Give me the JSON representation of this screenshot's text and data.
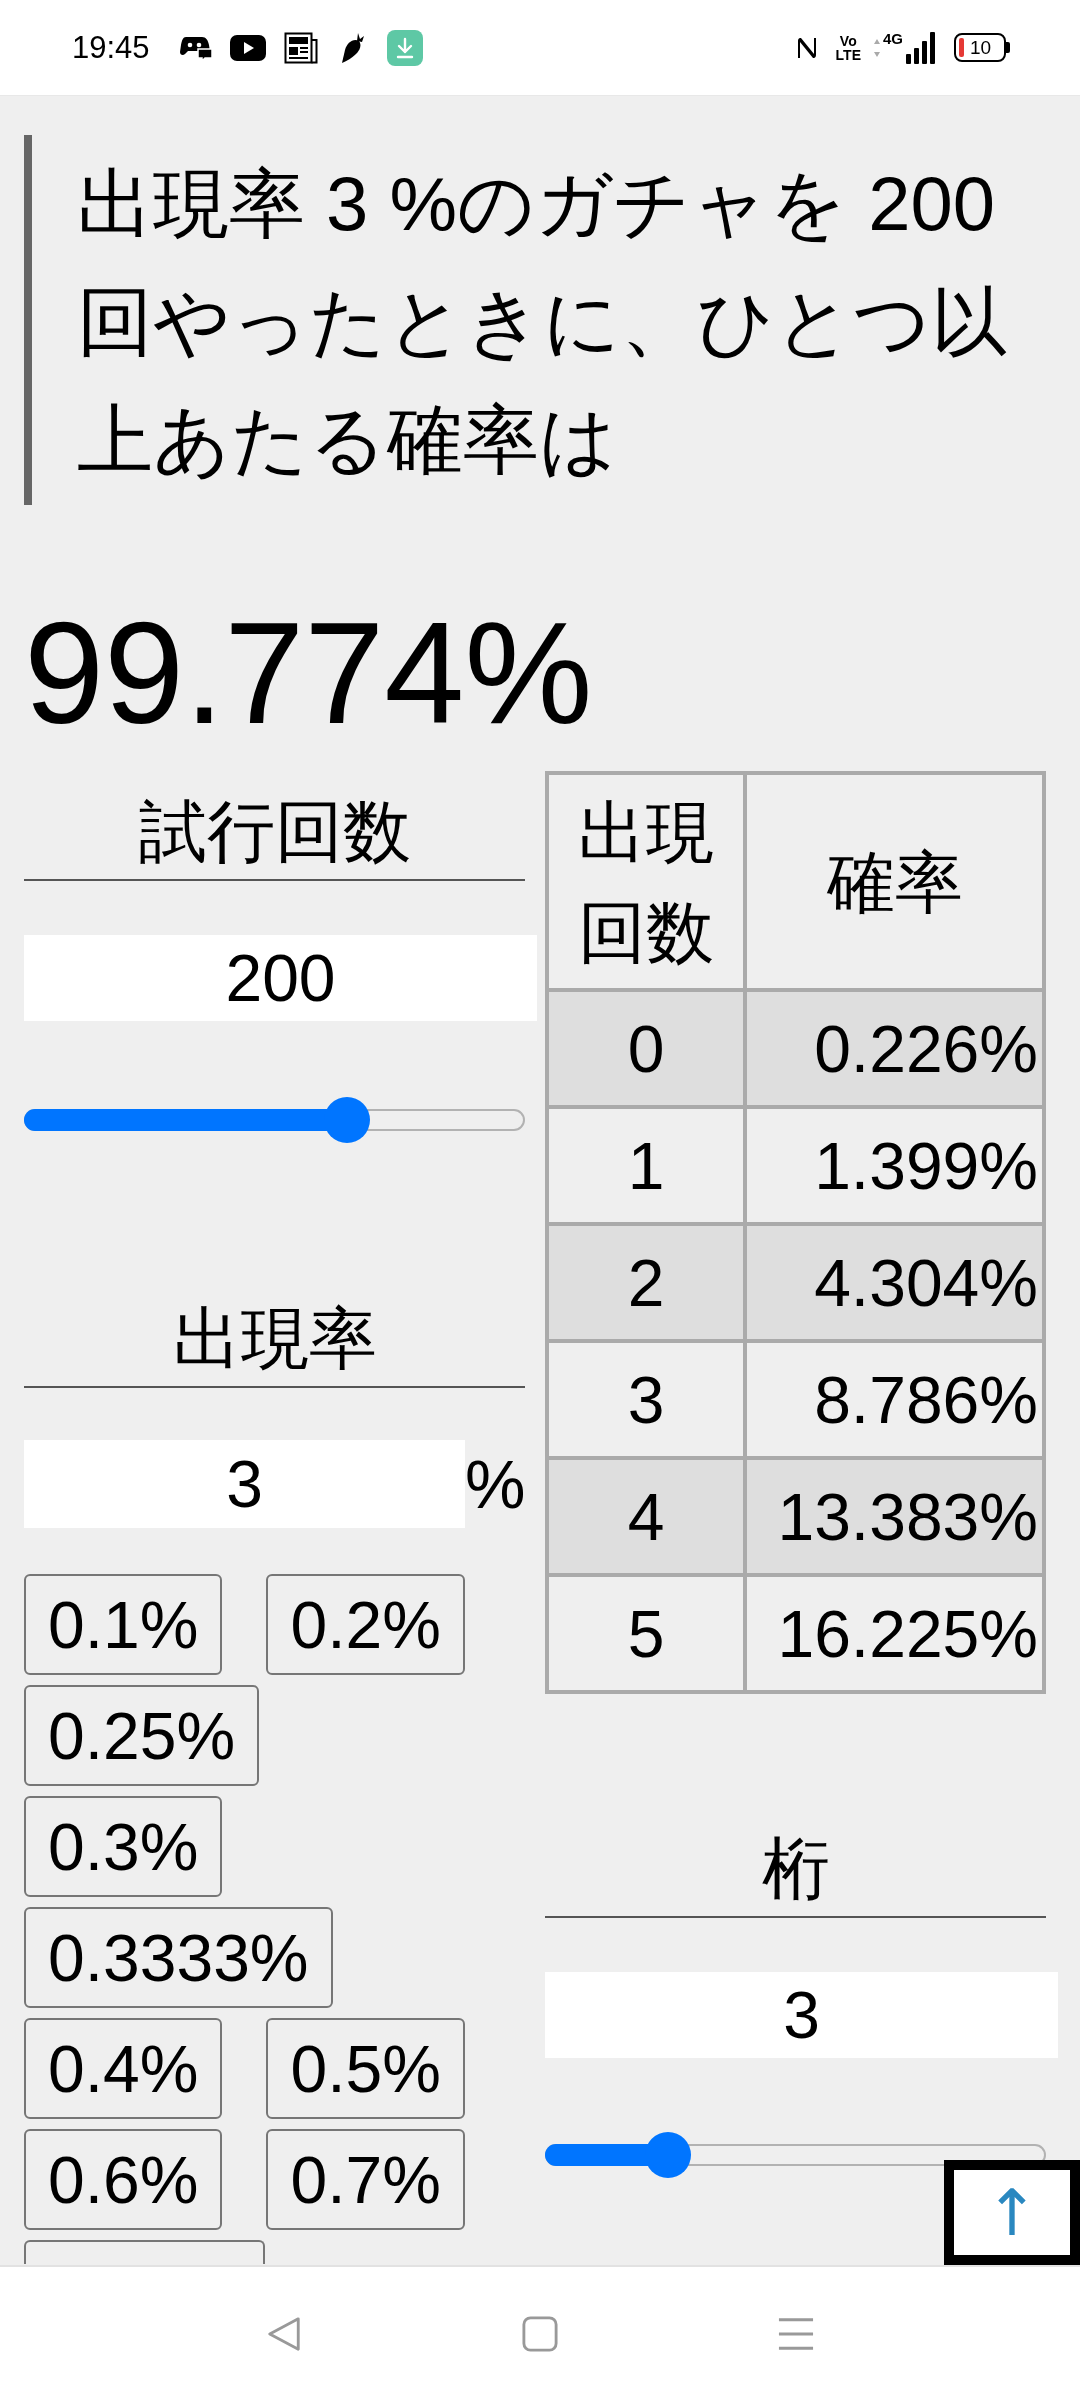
{
  "status_bar": {
    "time": "19:45",
    "volte_top": "Vo",
    "volte_bottom": "LTE",
    "network": "4G",
    "battery": "10"
  },
  "question": "出現率 3 %のガチャを 200 回やったときに、ひとつ以上あたる確率は",
  "result": "99.774%",
  "trials": {
    "heading": "試行回数",
    "value": "200",
    "level": 0.66
  },
  "rate": {
    "heading": "出現率",
    "value": "3",
    "unit": "%",
    "preset_rows": [
      [
        "0.1%",
        "0.2%"
      ],
      [
        "0.25%"
      ],
      [
        "0.3%"
      ],
      [
        "0.3333%"
      ],
      [
        "0.4%",
        "0.5%"
      ],
      [
        "0.6%",
        "0.7%"
      ]
    ],
    "clipped_button_below": true
  },
  "table": {
    "columns": [
      "出現回数",
      "確率"
    ],
    "rows": [
      [
        "0",
        "0.226%"
      ],
      [
        "1",
        "1.399%"
      ],
      [
        "2",
        "4.304%"
      ],
      [
        "3",
        "8.786%"
      ],
      [
        "4",
        "13.383%"
      ],
      [
        "5",
        "16.225%"
      ]
    ]
  },
  "digits": {
    "heading": "桁",
    "value": "3",
    "level": 0.22
  },
  "scroll_top_button": "↑"
}
